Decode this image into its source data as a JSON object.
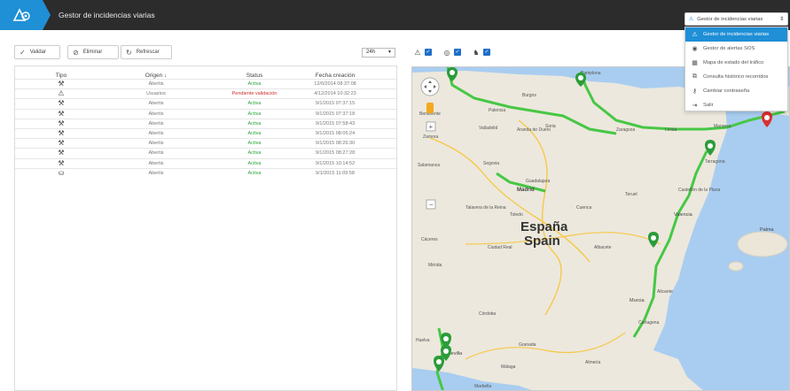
{
  "app": {
    "title": "Gestor de incidencias viarias"
  },
  "toolbar": {
    "validar": "Validar",
    "eliminar": "Eliminar",
    "refrescar": "Refrescar",
    "range": "24h"
  },
  "table": {
    "headers": {
      "tipo": "Tipo",
      "origen": "Origen",
      "status": "Status",
      "fecha": "Fecha creación"
    },
    "sort_indicator": "↓",
    "rows": [
      {
        "icon": "roadwork-icon",
        "origen": "Abertis",
        "status": "Activa",
        "fecha": "12/6/2014 08:37:08",
        "status_kind": "ok"
      },
      {
        "icon": "warning-icon",
        "origen": "Usuarios",
        "status": "Pendiente validación",
        "fecha": "4/12/2014 10:32:23",
        "status_kind": "pending"
      },
      {
        "icon": "roadwork-icon",
        "origen": "Abertis",
        "status": "Activa",
        "fecha": "9/1/2015 07:37:15",
        "status_kind": "ok"
      },
      {
        "icon": "roadwork-icon",
        "origen": "Abertis",
        "status": "Activa",
        "fecha": "9/1/2015 07:37:18",
        "status_kind": "ok"
      },
      {
        "icon": "roadwork-icon",
        "origen": "Abertis",
        "status": "Activa",
        "fecha": "9/1/2015 07:58:43",
        "status_kind": "ok"
      },
      {
        "icon": "roadwork-icon",
        "origen": "Abertis",
        "status": "Activa",
        "fecha": "9/1/2015 08:05:24",
        "status_kind": "ok"
      },
      {
        "icon": "roadwork-icon",
        "origen": "Abertis",
        "status": "Activa",
        "fecha": "9/1/2015 08:26:30",
        "status_kind": "ok"
      },
      {
        "icon": "roadwork-icon",
        "origen": "Abertis",
        "status": "Activa",
        "fecha": "9/1/2015 08:27:28",
        "status_kind": "ok"
      },
      {
        "icon": "roadwork-icon",
        "origen": "Abertis",
        "status": "Activa",
        "fecha": "9/1/2015 10:14:52",
        "status_kind": "ok"
      },
      {
        "icon": "spill-icon",
        "origen": "Abertis",
        "status": "Activa",
        "fecha": "9/1/2015 11:09:58",
        "status_kind": "ok"
      }
    ]
  },
  "map": {
    "country_label_1": "España",
    "country_label_2": "Spain",
    "cities": [
      "Pamplona",
      "Burgos",
      "Palencia",
      "Valladolid",
      "Soria",
      "Zaragoza",
      "Lleida",
      "Manresa",
      "Zamora",
      "Salamanca",
      "Segovia",
      "Madrid",
      "Guadalajara",
      "Cuenca",
      "Toledo",
      "Talavera de la Reina",
      "Cáceres",
      "Mérida",
      "Ciudad Real",
      "Albacete",
      "Valencia",
      "Castellón de la Plana",
      "Alicante",
      "Murcia",
      "Cartagena",
      "Córdoba",
      "Sevilla",
      "Granada",
      "Almería",
      "Málaga",
      "Marbella",
      "Huelva",
      "Palma",
      "Teruel",
      "Tarragona",
      "Benavente",
      "Aranda de Duero"
    ]
  },
  "menu": {
    "current": "Gestor de incidencias viarias",
    "items": [
      {
        "label": "Gestor de incidencias viarias",
        "icon": "incident-icon",
        "selected": true
      },
      {
        "label": "Gestor de alertas SOS",
        "icon": "sos-icon",
        "selected": false
      },
      {
        "label": "Mapa de estado del tráfico",
        "icon": "map-icon",
        "selected": false
      },
      {
        "label": "Consulta histórico recorridos",
        "icon": "history-icon",
        "selected": false
      },
      {
        "label": "Cambiar contraseña",
        "icon": "key-icon",
        "selected": false
      },
      {
        "label": "Salir",
        "icon": "exit-icon",
        "selected": false
      }
    ]
  },
  "colors": {
    "accent": "#1f8fd6",
    "topbar": "#2c2c2c",
    "active": "#2aa33a",
    "pending": "#d02c2c",
    "route": "#3cc83c"
  }
}
